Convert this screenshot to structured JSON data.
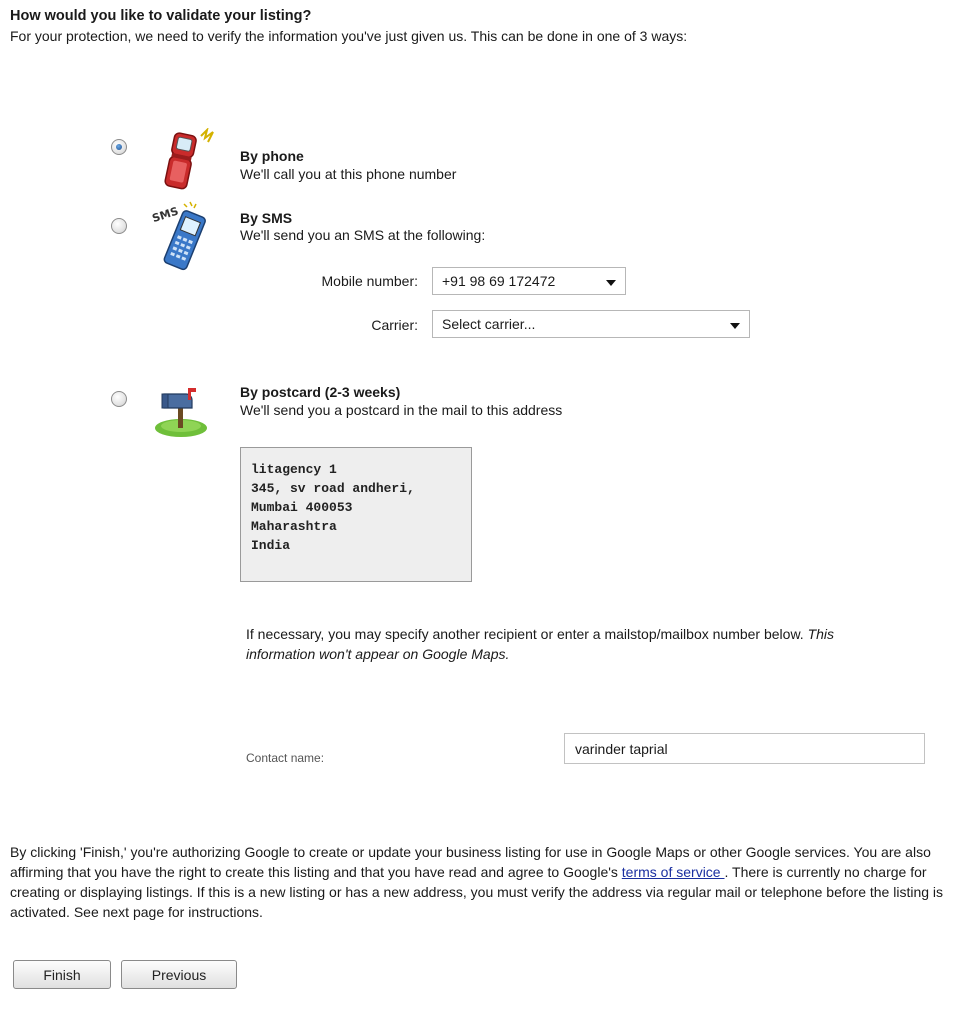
{
  "heading": "How would you like to validate your listing?",
  "intro": "For your protection, we need to verify the information you've just given us. This can be done in one of 3 ways:",
  "options": [
    {
      "id": "phone",
      "title": "By phone",
      "desc": "We'll call you at this phone number",
      "selected": true,
      "icon": "flip-phone-icon"
    },
    {
      "id": "sms",
      "title": "By SMS",
      "desc": "We'll send you an SMS at the following:",
      "selected": false,
      "icon": "sms-phone-icon"
    },
    {
      "id": "postcard",
      "title": "By postcard (2-3 weeks)",
      "desc": "We'll send you a postcard in the mail to this address",
      "selected": false,
      "icon": "mailbox-icon"
    }
  ],
  "sms": {
    "mobile_label": "Mobile number:",
    "mobile_value": "+91 98 69 172472",
    "carrier_label": "Carrier:",
    "carrier_value": "Select carrier..."
  },
  "address": {
    "lines": [
      "litagency 1",
      "345, sv road andheri,",
      "Mumbai 400053",
      "Maharashtra",
      "India"
    ]
  },
  "note": {
    "text": "If necessary, you may specify another recipient or enter a mailstop/mailbox number below. ",
    "italic": "This information won't appear on Google Maps."
  },
  "contact": {
    "label": "Contact name:",
    "value": "varinder taprial"
  },
  "legal": {
    "before_link": "By clicking 'Finish,' you're authorizing Google to create or update your business listing for use in Google Maps or other Google services. You are also affirming that you have the right to create this listing and that you have read and agree to Google's ",
    "link": "terms of service ",
    "after_link": ". There is currently no charge for creating or displaying listings. If this is a new listing or has a new address, you must verify the address via regular mail or telephone before the listing is activated. See next page for instructions."
  },
  "buttons": {
    "finish": "Finish",
    "previous": "Previous"
  },
  "colors": {
    "link": "#1a2fa0",
    "radio_selected": "#1f4f8f"
  }
}
